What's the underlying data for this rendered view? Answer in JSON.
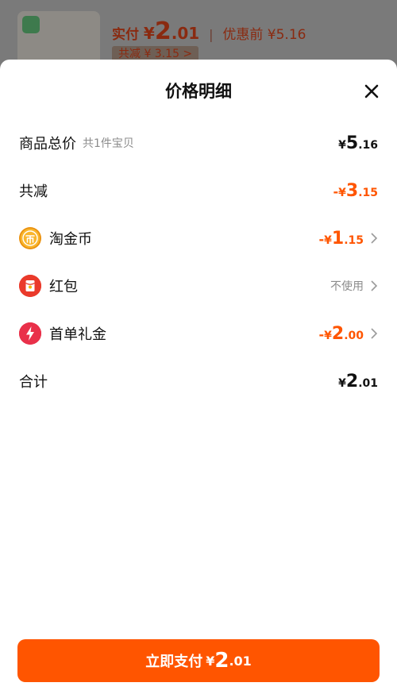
{
  "background": {
    "pay_label": "实付",
    "pay_currency": "¥",
    "pay_int": "2",
    "pay_dec": ".01",
    "separator": "|",
    "original_label": "优惠前 ¥5.16",
    "saved_label": "共减 ¥ 3.15 >"
  },
  "sheet": {
    "title": "价格明细",
    "rows": {
      "total": {
        "label": "商品总价",
        "sub": "共1件宝贝",
        "yen": "¥",
        "int": "5",
        "dec": ".16"
      },
      "discount": {
        "label": "共减",
        "sign": "-",
        "yen": "¥",
        "int": "3",
        "dec": ".15"
      },
      "coins": {
        "label": "淘金币",
        "sign": "-",
        "yen": "¥",
        "int": "1",
        "dec": ".15",
        "icon": "coin-icon"
      },
      "redpacket": {
        "label": "红包",
        "value": "不使用",
        "icon": "red-packet-icon"
      },
      "firstorder": {
        "label": "首单礼金",
        "sign": "-",
        "yen": "¥",
        "int": "2",
        "dec": ".00",
        "icon": "lightning-icon"
      },
      "sum": {
        "label": "合计",
        "yen": "¥",
        "int": "2",
        "dec": ".01"
      }
    }
  },
  "pay_button": {
    "label": "立即支付",
    "yen": "¥",
    "int": "2",
    "dec": ".01"
  },
  "colors": {
    "accent": "#ff5500",
    "text": "#111111",
    "muted": "#8c8c8c"
  }
}
